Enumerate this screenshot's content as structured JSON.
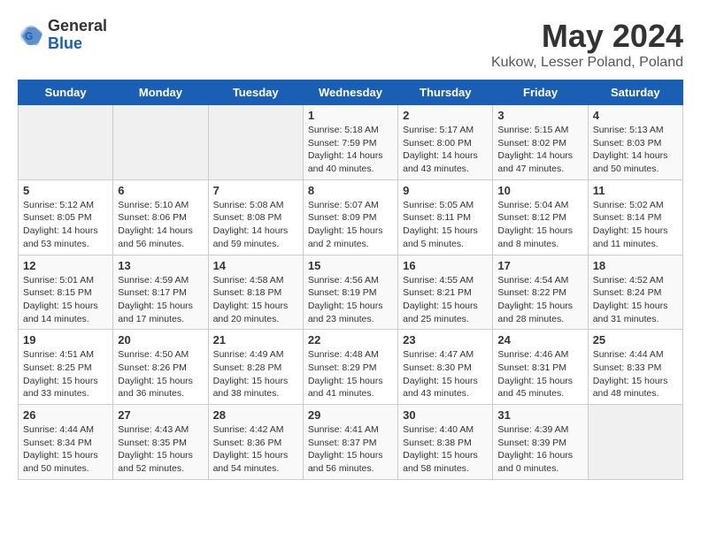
{
  "header": {
    "logo_general": "General",
    "logo_blue": "Blue",
    "title": "May 2024",
    "location": "Kukow, Lesser Poland, Poland"
  },
  "days_of_week": [
    "Sunday",
    "Monday",
    "Tuesday",
    "Wednesday",
    "Thursday",
    "Friday",
    "Saturday"
  ],
  "weeks": [
    [
      {
        "day": "",
        "info": ""
      },
      {
        "day": "",
        "info": ""
      },
      {
        "day": "",
        "info": ""
      },
      {
        "day": "1",
        "info": "Sunrise: 5:18 AM\nSunset: 7:59 PM\nDaylight: 14 hours\nand 40 minutes."
      },
      {
        "day": "2",
        "info": "Sunrise: 5:17 AM\nSunset: 8:00 PM\nDaylight: 14 hours\nand 43 minutes."
      },
      {
        "day": "3",
        "info": "Sunrise: 5:15 AM\nSunset: 8:02 PM\nDaylight: 14 hours\nand 47 minutes."
      },
      {
        "day": "4",
        "info": "Sunrise: 5:13 AM\nSunset: 8:03 PM\nDaylight: 14 hours\nand 50 minutes."
      }
    ],
    [
      {
        "day": "5",
        "info": "Sunrise: 5:12 AM\nSunset: 8:05 PM\nDaylight: 14 hours\nand 53 minutes."
      },
      {
        "day": "6",
        "info": "Sunrise: 5:10 AM\nSunset: 8:06 PM\nDaylight: 14 hours\nand 56 minutes."
      },
      {
        "day": "7",
        "info": "Sunrise: 5:08 AM\nSunset: 8:08 PM\nDaylight: 14 hours\nand 59 minutes."
      },
      {
        "day": "8",
        "info": "Sunrise: 5:07 AM\nSunset: 8:09 PM\nDaylight: 15 hours\nand 2 minutes."
      },
      {
        "day": "9",
        "info": "Sunrise: 5:05 AM\nSunset: 8:11 PM\nDaylight: 15 hours\nand 5 minutes."
      },
      {
        "day": "10",
        "info": "Sunrise: 5:04 AM\nSunset: 8:12 PM\nDaylight: 15 hours\nand 8 minutes."
      },
      {
        "day": "11",
        "info": "Sunrise: 5:02 AM\nSunset: 8:14 PM\nDaylight: 15 hours\nand 11 minutes."
      }
    ],
    [
      {
        "day": "12",
        "info": "Sunrise: 5:01 AM\nSunset: 8:15 PM\nDaylight: 15 hours\nand 14 minutes."
      },
      {
        "day": "13",
        "info": "Sunrise: 4:59 AM\nSunset: 8:17 PM\nDaylight: 15 hours\nand 17 minutes."
      },
      {
        "day": "14",
        "info": "Sunrise: 4:58 AM\nSunset: 8:18 PM\nDaylight: 15 hours\nand 20 minutes."
      },
      {
        "day": "15",
        "info": "Sunrise: 4:56 AM\nSunset: 8:19 PM\nDaylight: 15 hours\nand 23 minutes."
      },
      {
        "day": "16",
        "info": "Sunrise: 4:55 AM\nSunset: 8:21 PM\nDaylight: 15 hours\nand 25 minutes."
      },
      {
        "day": "17",
        "info": "Sunrise: 4:54 AM\nSunset: 8:22 PM\nDaylight: 15 hours\nand 28 minutes."
      },
      {
        "day": "18",
        "info": "Sunrise: 4:52 AM\nSunset: 8:24 PM\nDaylight: 15 hours\nand 31 minutes."
      }
    ],
    [
      {
        "day": "19",
        "info": "Sunrise: 4:51 AM\nSunset: 8:25 PM\nDaylight: 15 hours\nand 33 minutes."
      },
      {
        "day": "20",
        "info": "Sunrise: 4:50 AM\nSunset: 8:26 PM\nDaylight: 15 hours\nand 36 minutes."
      },
      {
        "day": "21",
        "info": "Sunrise: 4:49 AM\nSunset: 8:28 PM\nDaylight: 15 hours\nand 38 minutes."
      },
      {
        "day": "22",
        "info": "Sunrise: 4:48 AM\nSunset: 8:29 PM\nDaylight: 15 hours\nand 41 minutes."
      },
      {
        "day": "23",
        "info": "Sunrise: 4:47 AM\nSunset: 8:30 PM\nDaylight: 15 hours\nand 43 minutes."
      },
      {
        "day": "24",
        "info": "Sunrise: 4:46 AM\nSunset: 8:31 PM\nDaylight: 15 hours\nand 45 minutes."
      },
      {
        "day": "25",
        "info": "Sunrise: 4:44 AM\nSunset: 8:33 PM\nDaylight: 15 hours\nand 48 minutes."
      }
    ],
    [
      {
        "day": "26",
        "info": "Sunrise: 4:44 AM\nSunset: 8:34 PM\nDaylight: 15 hours\nand 50 minutes."
      },
      {
        "day": "27",
        "info": "Sunrise: 4:43 AM\nSunset: 8:35 PM\nDaylight: 15 hours\nand 52 minutes."
      },
      {
        "day": "28",
        "info": "Sunrise: 4:42 AM\nSunset: 8:36 PM\nDaylight: 15 hours\nand 54 minutes."
      },
      {
        "day": "29",
        "info": "Sunrise: 4:41 AM\nSunset: 8:37 PM\nDaylight: 15 hours\nand 56 minutes."
      },
      {
        "day": "30",
        "info": "Sunrise: 4:40 AM\nSunset: 8:38 PM\nDaylight: 15 hours\nand 58 minutes."
      },
      {
        "day": "31",
        "info": "Sunrise: 4:39 AM\nSunset: 8:39 PM\nDaylight: 16 hours\nand 0 minutes."
      },
      {
        "day": "",
        "info": ""
      }
    ]
  ]
}
